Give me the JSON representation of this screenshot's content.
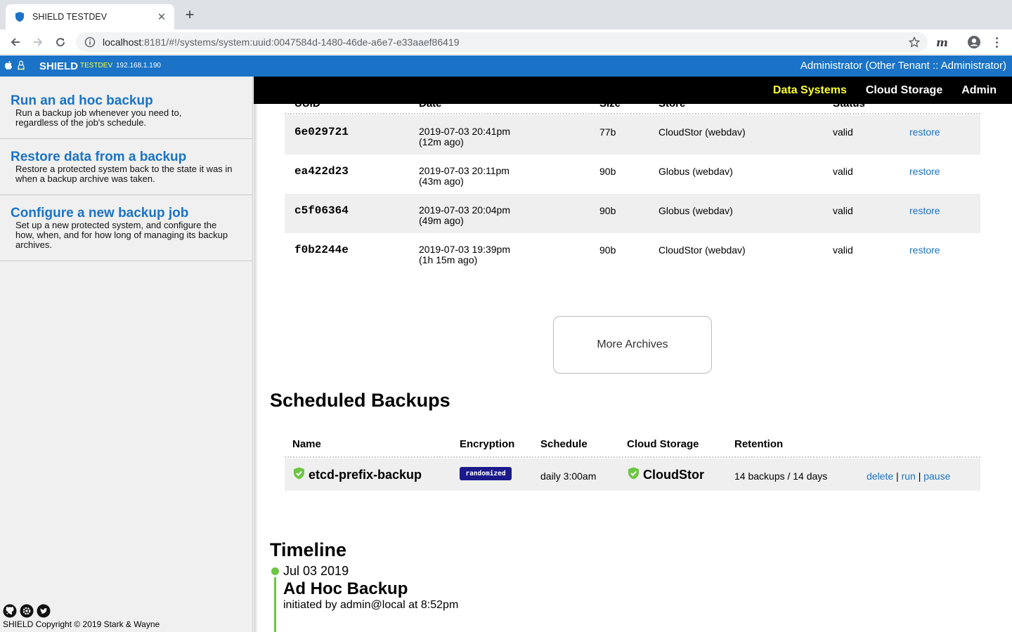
{
  "browser": {
    "tab_title": "SHIELD TESTDEV",
    "tab_close": "✕",
    "new_tab": "+",
    "url_host": "localhost",
    "url_rest": ":8181/#!/systems/system:uuid:0047584d-1480-46de-a6e7-e33aaef86419",
    "extension_label": "m"
  },
  "appbar": {
    "brand": "SHIELD",
    "env": "TESTDEV",
    "ip": "192.168.1.190",
    "user": "Administrator (Other Tenant :: Administrator)"
  },
  "nav": {
    "items": [
      "Data Systems",
      "Cloud Storage",
      "Admin"
    ],
    "active": "Data Systems"
  },
  "sidebar": {
    "items": [
      {
        "title": "Run an ad hoc backup",
        "desc": "Run a backup job whenever you need to, regardless of the job's schedule."
      },
      {
        "title": "Restore data from a backup",
        "desc": "Restore a protected system back to the state it was in when a backup archive was taken."
      },
      {
        "title": "Configure a new backup job",
        "desc": "Set up a new protected system, and configure the how, when, and for how long of managing its backup archives."
      }
    ],
    "copyright": "SHIELD Copyright © 2019 Stark & Wayne"
  },
  "archives": {
    "headers": [
      "UUID",
      "Date",
      "Size",
      "Store",
      "Status"
    ],
    "rows": [
      {
        "uuid": "6e029721",
        "date": "2019-07-03 20:41pm",
        "ago": "(12m ago)",
        "size": "77b",
        "store": "CloudStor (webdav)",
        "status": "valid",
        "action": "restore"
      },
      {
        "uuid": "ea422d23",
        "date": "2019-07-03 20:11pm",
        "ago": "(43m ago)",
        "size": "90b",
        "store": "Globus (webdav)",
        "status": "valid",
        "action": "restore"
      },
      {
        "uuid": "c5f06364",
        "date": "2019-07-03 20:04pm",
        "ago": "(49m ago)",
        "size": "90b",
        "store": "Globus (webdav)",
        "status": "valid",
        "action": "restore"
      },
      {
        "uuid": "f0b2244e",
        "date": "2019-07-03 19:39pm",
        "ago": "(1h 15m ago)",
        "size": "90b",
        "store": "CloudStor (webdav)",
        "status": "valid",
        "action": "restore"
      }
    ],
    "more_label": "More Archives"
  },
  "scheduled": {
    "title": "Scheduled Backups",
    "headers": [
      "Name",
      "Encryption",
      "Schedule",
      "Cloud Storage",
      "Retention"
    ],
    "job": {
      "name": "etcd-prefix-backup",
      "encryption": "randomized",
      "schedule": "daily 3:00am",
      "storage": "CloudStor",
      "retention": "14 backups / 14 days",
      "delete": "delete",
      "run": "run",
      "pause": "pause",
      "sep": "|"
    }
  },
  "timeline": {
    "title": "Timeline",
    "date": "Jul 03 2019",
    "event_title": "Ad Hoc Backup",
    "event_desc": "initiated by admin@local at 8:52pm"
  },
  "colors": {
    "brand_blue": "#1a73c6",
    "nav_active": "#ffff33",
    "ok_green": "#6cc644",
    "badge_navy": "#1a1a8a"
  },
  "icons": [
    "shield-icon",
    "back-icon",
    "forward-icon",
    "reload-icon",
    "info-icon",
    "star-icon",
    "profile-icon",
    "menu-icon",
    "apple-icon",
    "linux-icon",
    "check-shield-icon",
    "github-icon",
    "gear-icon",
    "twitter-icon"
  ]
}
